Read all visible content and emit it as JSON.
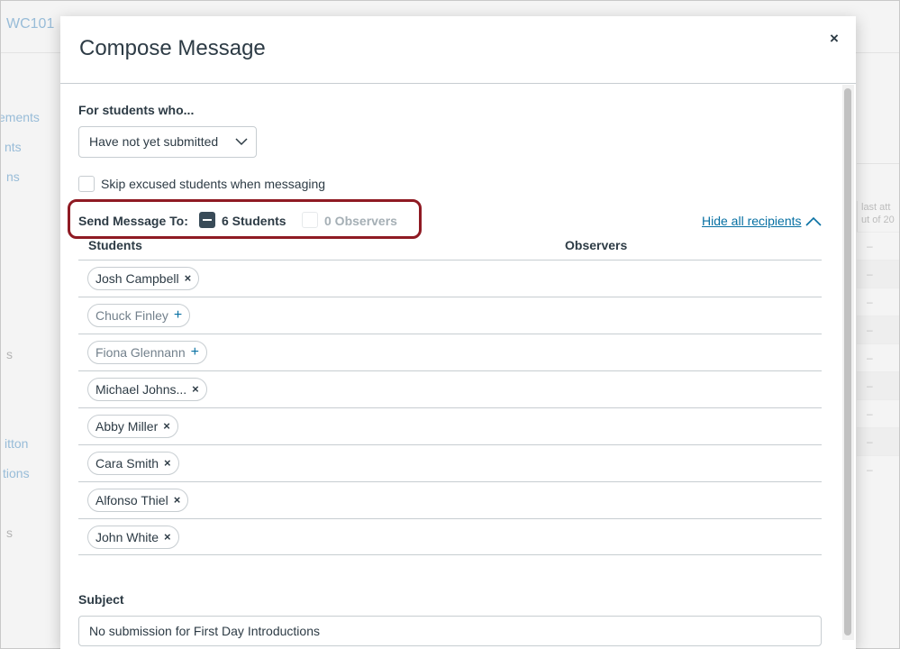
{
  "background": {
    "course_code": "WC101",
    "nav_fragments": [
      "ements",
      "nts",
      "ns",
      "s",
      "itton",
      "tions",
      "s"
    ],
    "grade_column_header": "last att\nut of 20",
    "dash": "–"
  },
  "modal": {
    "title": "Compose Message",
    "close_icon": "×",
    "criteria_label": "For students who...",
    "criteria_selected": "Have not yet submitted",
    "skip_excused_label": "Skip excused students when messaging",
    "send_to_label": "Send Message To:",
    "students_count_label": "6 Students",
    "observers_count_label": "0 Observers",
    "hide_recipients_link": "Hide all recipients",
    "columns": {
      "students": "Students",
      "observers": "Observers"
    },
    "recipients": [
      {
        "name": "Josh Campbell",
        "included": true,
        "icon": "×"
      },
      {
        "name": "Chuck Finley",
        "included": false,
        "icon": "+"
      },
      {
        "name": "Fiona Glennann",
        "included": false,
        "icon": "+"
      },
      {
        "name": "Michael Johns...",
        "included": true,
        "icon": "×"
      },
      {
        "name": "Abby Miller",
        "included": true,
        "icon": "×"
      },
      {
        "name": "Cara Smith",
        "included": true,
        "icon": "×"
      },
      {
        "name": "Alfonso Thiel",
        "included": true,
        "icon": "×"
      },
      {
        "name": "John White",
        "included": true,
        "icon": "×"
      }
    ],
    "subject_label": "Subject",
    "subject_value": "No submission for First Day Introductions"
  },
  "colors": {
    "text": "#2d3b45",
    "link": "#0770a3",
    "highlight_border": "#8f1a23",
    "indeterminate_check": "#394b58",
    "muted_text": "#73818c"
  }
}
